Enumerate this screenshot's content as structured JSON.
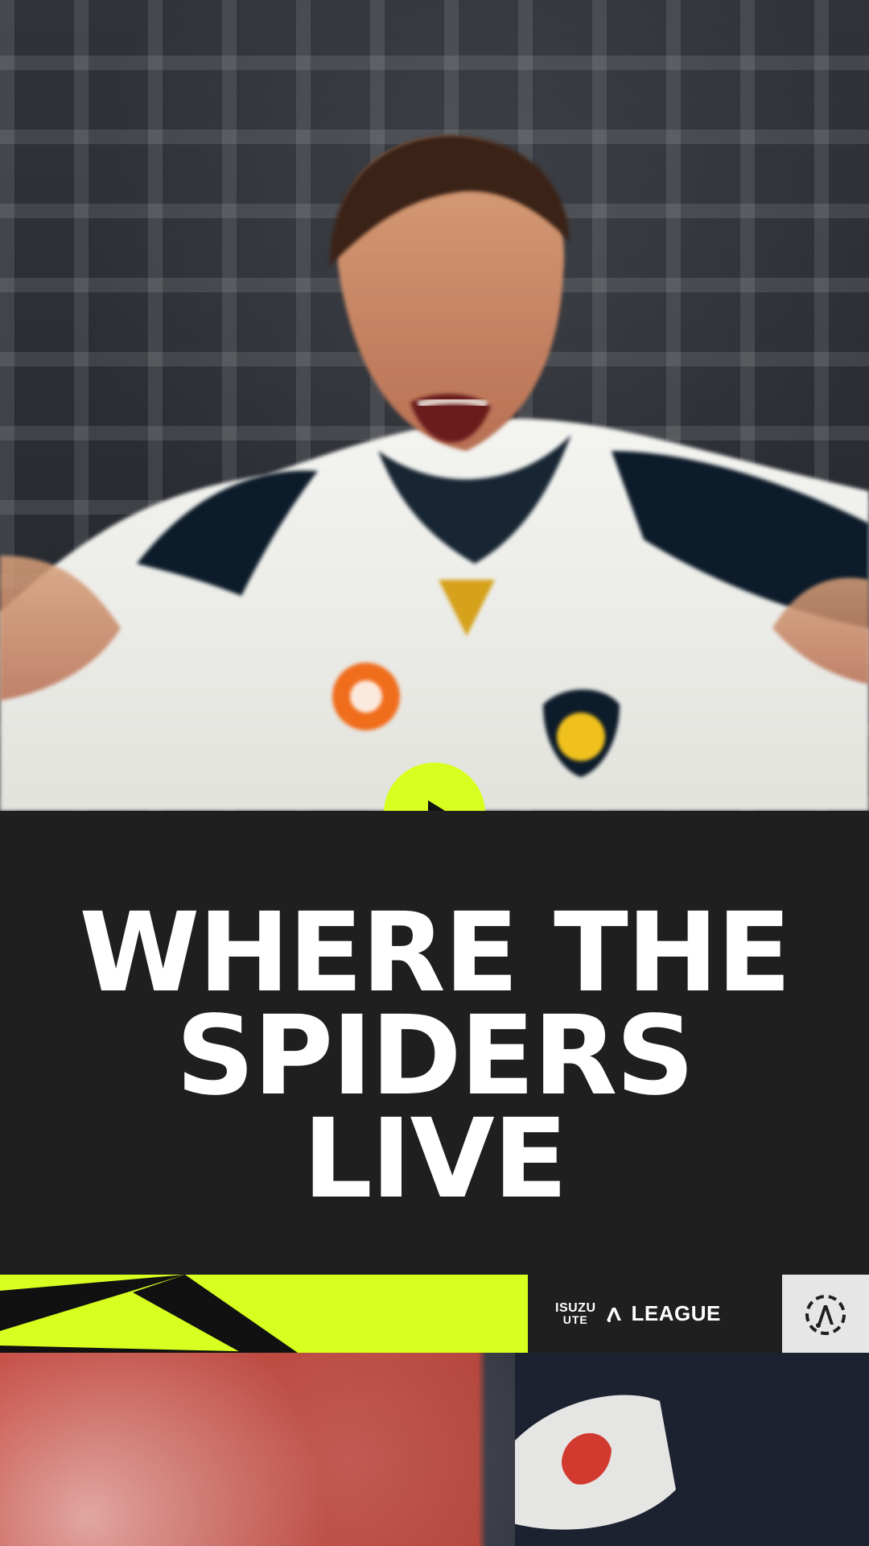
{
  "page": {
    "title_lines": [
      "WHERE THE",
      "SPIDERS",
      "LIVE"
    ]
  },
  "video": {
    "play_icon": "play-icon"
  },
  "branding": {
    "brand_prefix_top": "ISUZU",
    "brand_prefix_bottom": "UTE",
    "league_name": "LEAGUE",
    "league_mark_icon": "a-league-mark-icon",
    "badge_icon": "a-league-badge-icon"
  },
  "colors": {
    "accent_lime": "#d7ff1f",
    "panel_dark": "#1f1f1f",
    "text_white": "#ffffff",
    "badge_light": "#e6e6e6"
  }
}
